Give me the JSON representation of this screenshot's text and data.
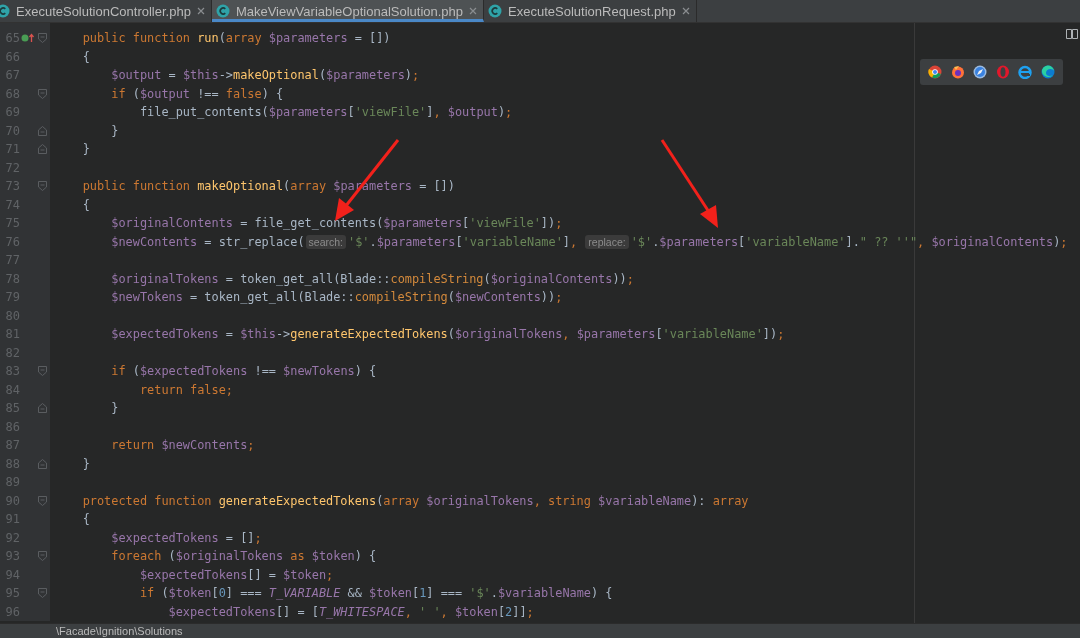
{
  "tabs": [
    {
      "label": "ExecuteSolutionController.php",
      "selected": false
    },
    {
      "label": "MakeViewVariableOptionalSolution.php",
      "selected": true
    },
    {
      "label": "ExecuteSolutionRequest.php",
      "selected": false
    }
  ],
  "editor": {
    "lines": [
      {
        "number": "65",
        "fold_start": true,
        "fold_end": false,
        "override_marker": true,
        "tokens": [
          {
            "kind": "kw",
            "text": "    public function "
          },
          {
            "kind": "fn",
            "text": "run"
          },
          {
            "kind": "txt",
            "text": "("
          },
          {
            "kind": "kw",
            "text": "array "
          },
          {
            "kind": "var",
            "text": "$parameters"
          },
          {
            "kind": "txt",
            "text": " = [])"
          }
        ]
      },
      {
        "number": "66",
        "fold_start": false,
        "fold_end": false,
        "override_marker": false,
        "tokens": [
          {
            "kind": "txt",
            "text": "    {"
          }
        ]
      },
      {
        "number": "67",
        "fold_start": false,
        "fold_end": false,
        "override_marker": false,
        "tokens": [
          {
            "kind": "var",
            "text": "        $output"
          },
          {
            "kind": "txt",
            "text": " = "
          },
          {
            "kind": "var",
            "text": "$this"
          },
          {
            "kind": "txt",
            "text": "->"
          },
          {
            "kind": "fn",
            "text": "makeOptional"
          },
          {
            "kind": "txt",
            "text": "("
          },
          {
            "kind": "var",
            "text": "$parameters"
          },
          {
            "kind": "txt",
            "text": ")"
          },
          {
            "kind": "kw",
            "text": ";"
          }
        ]
      },
      {
        "number": "68",
        "fold_start": true,
        "fold_end": false,
        "override_marker": false,
        "tokens": [
          {
            "kind": "kw",
            "text": "        if"
          },
          {
            "kind": "txt",
            "text": " ("
          },
          {
            "kind": "var",
            "text": "$output"
          },
          {
            "kind": "txt",
            "text": " !== "
          },
          {
            "kind": "kw",
            "text": "false"
          },
          {
            "kind": "txt",
            "text": ") {"
          }
        ]
      },
      {
        "number": "69",
        "fold_start": false,
        "fold_end": false,
        "override_marker": false,
        "tokens": [
          {
            "kind": "txt",
            "text": "            file_put_contents("
          },
          {
            "kind": "var",
            "text": "$parameters"
          },
          {
            "kind": "txt",
            "text": "["
          },
          {
            "kind": "str",
            "text": "'viewFile'"
          },
          {
            "kind": "txt",
            "text": "]"
          },
          {
            "kind": "kw",
            "text": ", "
          },
          {
            "kind": "var",
            "text": "$output"
          },
          {
            "kind": "txt",
            "text": ")"
          },
          {
            "kind": "kw",
            "text": ";"
          }
        ]
      },
      {
        "number": "70",
        "fold_start": false,
        "fold_end": true,
        "override_marker": false,
        "tokens": [
          {
            "kind": "txt",
            "text": "        }"
          }
        ]
      },
      {
        "number": "71",
        "fold_start": false,
        "fold_end": true,
        "override_marker": false,
        "tokens": [
          {
            "kind": "txt",
            "text": "    }"
          }
        ]
      },
      {
        "number": "72",
        "fold_start": false,
        "fold_end": false,
        "override_marker": false
      },
      {
        "number": "73",
        "fold_start": true,
        "fold_end": false,
        "override_marker": false,
        "tokens": [
          {
            "kind": "kw",
            "text": "    public function "
          },
          {
            "kind": "fn",
            "text": "makeOptional"
          },
          {
            "kind": "txt",
            "text": "("
          },
          {
            "kind": "kw",
            "text": "array "
          },
          {
            "kind": "var",
            "text": "$parameters"
          },
          {
            "kind": "txt",
            "text": " = [])"
          }
        ]
      },
      {
        "number": "74",
        "fold_start": false,
        "fold_end": false,
        "override_marker": false,
        "tokens": [
          {
            "kind": "txt",
            "text": "    {"
          }
        ]
      },
      {
        "number": "75",
        "fold_start": false,
        "fold_end": false,
        "override_marker": false,
        "tokens": [
          {
            "kind": "var",
            "text": "        $originalContents"
          },
          {
            "kind": "txt",
            "text": " = file_get_contents("
          },
          {
            "kind": "var",
            "text": "$parameters"
          },
          {
            "kind": "txt",
            "text": "["
          },
          {
            "kind": "str",
            "text": "'viewFile'"
          },
          {
            "kind": "txt",
            "text": "])"
          },
          {
            "kind": "kw",
            "text": ";"
          }
        ]
      },
      {
        "number": "76",
        "fold_start": false,
        "fold_end": false,
        "override_marker": false,
        "tokens": [
          {
            "kind": "var",
            "text": "        $newContents"
          },
          {
            "kind": "txt",
            "text": " = str_replace("
          },
          {
            "kind": "hint",
            "text": "search:"
          },
          {
            "kind": "str",
            "text": "'$'"
          },
          {
            "kind": "txt",
            "text": "."
          },
          {
            "kind": "var",
            "text": "$parameters"
          },
          {
            "kind": "txt",
            "text": "["
          },
          {
            "kind": "str",
            "text": "'variableName'"
          },
          {
            "kind": "txt",
            "text": "]"
          },
          {
            "kind": "kw",
            "text": ", "
          },
          {
            "kind": "hint",
            "text": "replace:"
          },
          {
            "kind": "str",
            "text": "'$'"
          },
          {
            "kind": "txt",
            "text": "."
          },
          {
            "kind": "var",
            "text": "$parameters"
          },
          {
            "kind": "txt",
            "text": "["
          },
          {
            "kind": "str",
            "text": "'variableName'"
          },
          {
            "kind": "txt",
            "text": "]."
          },
          {
            "kind": "str",
            "text": "\" ?? ''\""
          },
          {
            "kind": "kw",
            "text": ", "
          },
          {
            "kind": "var",
            "text": "$originalContents"
          },
          {
            "kind": "txt",
            "text": ")"
          },
          {
            "kind": "kw",
            "text": ";"
          }
        ]
      },
      {
        "number": "77",
        "fold_start": false,
        "fold_end": false,
        "override_marker": false
      },
      {
        "number": "78",
        "fold_start": false,
        "fold_end": false,
        "override_marker": false,
        "tokens": [
          {
            "kind": "var",
            "text": "        $originalTokens"
          },
          {
            "kind": "txt",
            "text": " = token_get_all(Blade::"
          },
          {
            "kind": "static",
            "text": "compileString"
          },
          {
            "kind": "txt",
            "text": "("
          },
          {
            "kind": "var",
            "text": "$originalContents"
          },
          {
            "kind": "txt",
            "text": "))"
          },
          {
            "kind": "kw",
            "text": ";"
          }
        ]
      },
      {
        "number": "79",
        "fold_start": false,
        "fold_end": false,
        "override_marker": false,
        "tokens": [
          {
            "kind": "var",
            "text": "        $newTokens"
          },
          {
            "kind": "txt",
            "text": " = token_get_all(Blade::"
          },
          {
            "kind": "static",
            "text": "compileString"
          },
          {
            "kind": "txt",
            "text": "("
          },
          {
            "kind": "var",
            "text": "$newContents"
          },
          {
            "kind": "txt",
            "text": "))"
          },
          {
            "kind": "kw",
            "text": ";"
          }
        ]
      },
      {
        "number": "80",
        "fold_start": false,
        "fold_end": false,
        "override_marker": false
      },
      {
        "number": "81",
        "fold_start": false,
        "fold_end": false,
        "override_marker": false,
        "tokens": [
          {
            "kind": "var",
            "text": "        $expectedTokens"
          },
          {
            "kind": "txt",
            "text": " = "
          },
          {
            "kind": "var",
            "text": "$this"
          },
          {
            "kind": "txt",
            "text": "->"
          },
          {
            "kind": "fn",
            "text": "generateExpectedTokens"
          },
          {
            "kind": "txt",
            "text": "("
          },
          {
            "kind": "var",
            "text": "$originalTokens"
          },
          {
            "kind": "kw",
            "text": ", "
          },
          {
            "kind": "var",
            "text": "$parameters"
          },
          {
            "kind": "txt",
            "text": "["
          },
          {
            "kind": "str",
            "text": "'variableName'"
          },
          {
            "kind": "txt",
            "text": "])"
          },
          {
            "kind": "kw",
            "text": ";"
          }
        ]
      },
      {
        "number": "82",
        "fold_start": false,
        "fold_end": false,
        "override_marker": false
      },
      {
        "number": "83",
        "fold_start": true,
        "fold_end": false,
        "override_marker": false,
        "tokens": [
          {
            "kind": "kw",
            "text": "        if"
          },
          {
            "kind": "txt",
            "text": " ("
          },
          {
            "kind": "var",
            "text": "$expectedTokens"
          },
          {
            "kind": "txt",
            "text": " !== "
          },
          {
            "kind": "var",
            "text": "$newTokens"
          },
          {
            "kind": "txt",
            "text": ") {"
          }
        ]
      },
      {
        "number": "84",
        "fold_start": false,
        "fold_end": false,
        "override_marker": false,
        "tokens": [
          {
            "kind": "kw",
            "text": "            return false;"
          }
        ]
      },
      {
        "number": "85",
        "fold_start": false,
        "fold_end": true,
        "override_marker": false,
        "tokens": [
          {
            "kind": "txt",
            "text": "        }"
          }
        ]
      },
      {
        "number": "86",
        "fold_start": false,
        "fold_end": false,
        "override_marker": false
      },
      {
        "number": "87",
        "fold_start": false,
        "fold_end": false,
        "override_marker": false,
        "tokens": [
          {
            "kind": "kw",
            "text": "        return "
          },
          {
            "kind": "var",
            "text": "$newContents"
          },
          {
            "kind": "kw",
            "text": ";"
          }
        ]
      },
      {
        "number": "88",
        "fold_start": false,
        "fold_end": true,
        "override_marker": false,
        "tokens": [
          {
            "kind": "txt",
            "text": "    }"
          }
        ]
      },
      {
        "number": "89",
        "fold_start": false,
        "fold_end": false,
        "override_marker": false
      },
      {
        "number": "90",
        "fold_start": true,
        "fold_end": false,
        "override_marker": false,
        "tokens": [
          {
            "kind": "kw",
            "text": "    protected function "
          },
          {
            "kind": "fn",
            "text": "generateExpectedTokens"
          },
          {
            "kind": "txt",
            "text": "("
          },
          {
            "kind": "kw",
            "text": "array "
          },
          {
            "kind": "var",
            "text": "$originalTokens"
          },
          {
            "kind": "kw",
            "text": ", string "
          },
          {
            "kind": "var",
            "text": "$variableName"
          },
          {
            "kind": "txt",
            "text": "): "
          },
          {
            "kind": "kw",
            "text": "array"
          }
        ]
      },
      {
        "number": "91",
        "fold_start": false,
        "fold_end": false,
        "override_marker": false,
        "tokens": [
          {
            "kind": "txt",
            "text": "    {"
          }
        ]
      },
      {
        "number": "92",
        "fold_start": false,
        "fold_end": false,
        "override_marker": false,
        "tokens": [
          {
            "kind": "var",
            "text": "        $expectedTokens"
          },
          {
            "kind": "txt",
            "text": " = []"
          },
          {
            "kind": "kw",
            "text": ";"
          }
        ]
      },
      {
        "number": "93",
        "fold_start": true,
        "fold_end": false,
        "override_marker": false,
        "tokens": [
          {
            "kind": "kw",
            "text": "        foreach"
          },
          {
            "kind": "txt",
            "text": " ("
          },
          {
            "kind": "var",
            "text": "$originalTokens"
          },
          {
            "kind": "kw",
            "text": " as "
          },
          {
            "kind": "var",
            "text": "$token"
          },
          {
            "kind": "txt",
            "text": ") {"
          }
        ]
      },
      {
        "number": "94",
        "fold_start": false,
        "fold_end": false,
        "override_marker": false,
        "tokens": [
          {
            "kind": "var",
            "text": "            $expectedTokens"
          },
          {
            "kind": "txt",
            "text": "[] = "
          },
          {
            "kind": "var",
            "text": "$token"
          },
          {
            "kind": "kw",
            "text": ";"
          }
        ]
      },
      {
        "number": "95",
        "fold_start": true,
        "fold_end": false,
        "override_marker": false,
        "tokens": [
          {
            "kind": "kw",
            "text": "            if"
          },
          {
            "kind": "txt",
            "text": " ("
          },
          {
            "kind": "var",
            "text": "$token"
          },
          {
            "kind": "txt",
            "text": "["
          },
          {
            "kind": "num",
            "text": "0"
          },
          {
            "kind": "txt",
            "text": "] === "
          },
          {
            "kind": "const",
            "text": "T_VARIABLE"
          },
          {
            "kind": "txt",
            "text": " && "
          },
          {
            "kind": "var",
            "text": "$token"
          },
          {
            "kind": "txt",
            "text": "["
          },
          {
            "kind": "num",
            "text": "1"
          },
          {
            "kind": "txt",
            "text": "] === "
          },
          {
            "kind": "str",
            "text": "'$'"
          },
          {
            "kind": "txt",
            "text": "."
          },
          {
            "kind": "var",
            "text": "$variableName"
          },
          {
            "kind": "txt",
            "text": ") {"
          }
        ]
      },
      {
        "number": "96",
        "fold_start": false,
        "fold_end": false,
        "override_marker": false,
        "tokens": [
          {
            "kind": "var",
            "text": "                $expectedTokens"
          },
          {
            "kind": "txt",
            "text": "[] = ["
          },
          {
            "kind": "const",
            "text": "T_WHITESPACE"
          },
          {
            "kind": "kw",
            "text": ", "
          },
          {
            "kind": "str",
            "text": "' '"
          },
          {
            "kind": "kw",
            "text": ", "
          },
          {
            "kind": "var",
            "text": "$token"
          },
          {
            "kind": "txt",
            "text": "["
          },
          {
            "kind": "num",
            "text": "2"
          },
          {
            "kind": "txt",
            "text": "]]"
          },
          {
            "kind": "kw",
            "text": ";"
          }
        ]
      }
    ]
  },
  "status_bar": {
    "path": "\\Facade\\Ignition\\Solutions"
  }
}
